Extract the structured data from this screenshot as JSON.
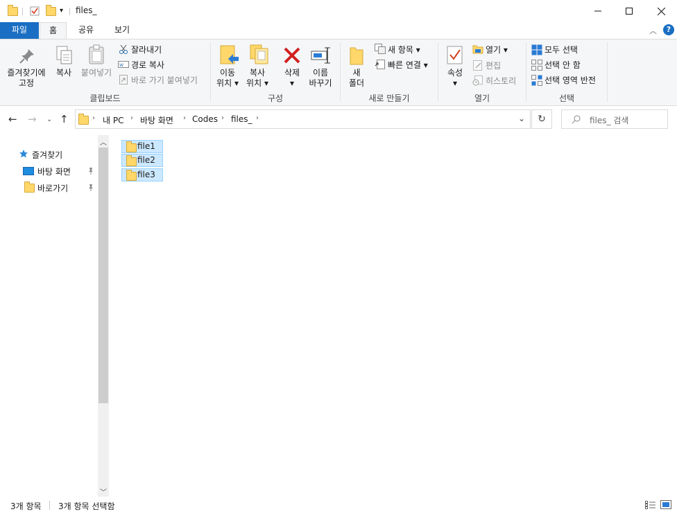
{
  "window": {
    "title": "files_"
  },
  "ribbon_tabs": [
    "파일",
    "홈",
    "공유",
    "보기"
  ],
  "clipboard": {
    "pin_label_1": "즐겨찾기에",
    "pin_label_2": "고정",
    "copy": "복사",
    "paste": "붙여넣기",
    "cut": "잘라내기",
    "copy_path": "경로 복사",
    "paste_shortcut": "바로 가기 붙여넣기",
    "group": "클립보드"
  },
  "organize": {
    "move_1": "이동",
    "move_2": "위치",
    "copy_1": "복사",
    "copy_2": "위치",
    "delete": "삭제",
    "rename_1": "이름",
    "rename_2": "바꾸기",
    "group": "구성"
  },
  "new": {
    "folder_1": "새",
    "folder_2": "폴더",
    "new_item": "새 항목",
    "easy_access": "빠른 연결",
    "group": "새로 만들기"
  },
  "open": {
    "properties": "속성",
    "open": "열기",
    "edit": "편집",
    "history": "히스토리",
    "group": "열기"
  },
  "select": {
    "select_all": "모두 선택",
    "select_none": "선택 안 함",
    "invert": "선택 영역 반전",
    "group": "선택"
  },
  "breadcrumb": [
    "내 PC",
    "바탕 화면",
    "Codes",
    "files_"
  ],
  "search": {
    "placeholder": "files_ 검색"
  },
  "nav_pane": {
    "quick_access": "즐겨찾기",
    "items": [
      "바탕 화면",
      "바로가기"
    ]
  },
  "files": [
    "file1",
    "file2",
    "file3"
  ],
  "status": {
    "count": "3개 항목",
    "selected": "3개 항목 선택함"
  },
  "colors": {
    "accent": "#1a6ec3",
    "selection": "#cce8ff",
    "folder": "#ffd76a"
  }
}
